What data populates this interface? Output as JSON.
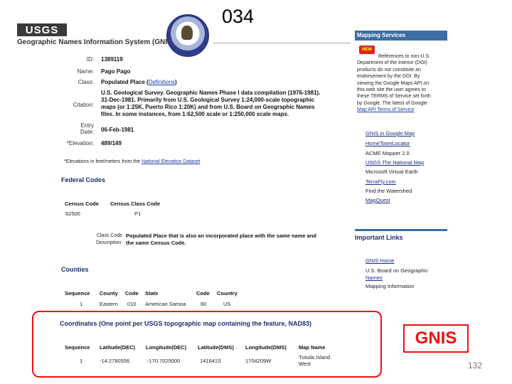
{
  "slide": {
    "title": "034",
    "page_number": "132"
  },
  "header": {
    "logo_text": "USGS",
    "app_title": "Geographic Names Information System (GNIS)"
  },
  "details": {
    "id_label": "ID:",
    "id_value": "1389119",
    "name_label": "Name:",
    "name_value": "Pago Pago",
    "class_label": "Class:",
    "class_value": "Populated Place (",
    "class_link": "Definitions",
    "class_close": ")",
    "citation_label": "Citation:",
    "citation_lines": [
      "U.S. Geological Survey. Geographic Names Phase I data compilation (1976-1981).",
      "31-Dec-1981. Primarily from U.S. Geological Survey 1:24,000-scale topographic",
      "maps (or 1:25K, Puerto Rico 1:20K) and from U.S. Board on Geographic Names",
      "files. In some instances, from 1:62,500 scale or 1:250,000 scale maps."
    ],
    "entry_date_label_1": "Entry",
    "entry_date_label_2": "Date:",
    "entry_date_value": "06-Feb-1981",
    "elevation_label": "*Elevation:",
    "elevation_value": "489/149",
    "elevation_note": "*Elevations in feet/meters from the ",
    "elevation_note_link": "National Elevation Dataset"
  },
  "federal_codes": {
    "heading": "Federal Codes",
    "col_census_code": "Census Code",
    "col_census_class": "Census Class Code",
    "census_code": "62500",
    "census_class": "P1",
    "class_code_label": "Class Code",
    "description_label": "Description:",
    "description_line1": "Populated Place that is also an incorporated place with the same name and",
    "description_line2": "the same Census Code."
  },
  "counties": {
    "heading": "Counties",
    "headers": [
      "Sequence",
      "County",
      "Code",
      "State",
      "Code",
      "Country"
    ],
    "row": [
      "1",
      "Eastern",
      "010",
      "American Samoa",
      "60",
      "US"
    ]
  },
  "coordinates": {
    "heading": "Coordinates (One point per USGS topographic map containing the feature, NAD83)",
    "headers": [
      "Sequence",
      "Latitude(DEC)",
      "Longitude(DEC)",
      "Latitude(DMS)",
      "Longitude(DMS)",
      "Map Name"
    ],
    "row": [
      "1",
      "-14.2780556",
      "-170.7025000",
      "141641S",
      "1704209W",
      "Tutuila Island",
      "West"
    ]
  },
  "sidebar": {
    "mapping_heading": "Mapping Services",
    "new_badge": "NEW",
    "disclaimer_lines": [
      "References to non-U.S.",
      "Department of the Interior (DOI)",
      "products do not constitute an",
      "endorsement by the DOI. By",
      "viewing the Google Maps API on",
      "this web site the user agrees to",
      "these TERMS of Service set forth",
      "by Google. The latest of Google"
    ],
    "disclaimer_link": "Map API Terms of Service",
    "mapping_links": [
      "GNIS in Google Map",
      "HomeTownLocator",
      "ACME Mapper 2.0",
      "USGS The National Map",
      "Microsoft Virtual Earth",
      "TerraFly.com",
      "Find the Watershed",
      "MapQuest"
    ],
    "important_heading": "Important Links",
    "important_links": [
      "GNIS Home",
      "U.S. Board on Geographic",
      "Names",
      "Mapping Information"
    ]
  },
  "callout": {
    "label": "GNIS"
  },
  "colors": {
    "highlight": "#e11111",
    "accent": "#3b6ea3"
  }
}
